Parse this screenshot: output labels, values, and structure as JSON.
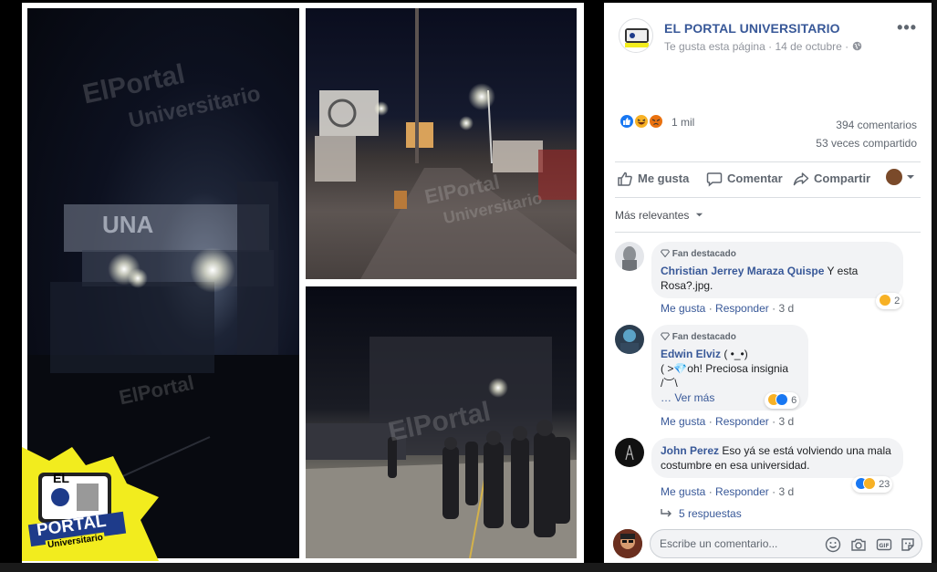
{
  "photos": {
    "watermark_text_1": "ElPortal",
    "watermark_text_2": "Universitario",
    "sign_text": "UNA",
    "logo_line1": "EL",
    "logo_line2": "PORTAL",
    "logo_line3": "Universitario"
  },
  "post": {
    "page_name": "EL PORTAL UNIVERSITARIO",
    "liked_label": "Te gusta esta página",
    "separator": "·",
    "date": "14 de octubre",
    "visibility_icon": "globe-icon",
    "more_label": "•••"
  },
  "summary": {
    "reaction_count": "1 mil",
    "comments_count": "394 comentarios",
    "shares_count": "53 veces compartido",
    "reaction_icons": [
      "like-icon",
      "haha-icon",
      "angry-icon"
    ],
    "colors": {
      "like": "#1877f2",
      "haha": "#f7b125",
      "angry": "#e9710f"
    }
  },
  "actions": {
    "like_label": "Me gusta",
    "comment_label": "Comentar",
    "share_label": "Compartir"
  },
  "filter": {
    "label": "Más relevantes"
  },
  "comments": [
    {
      "badge": "Fan destacado",
      "author": "Christian Jerrey Maraza Quispe",
      "text": " Y esta Rosa?.jpg.",
      "like": "Me gusta",
      "reply": "Responder",
      "time": "3 d",
      "reaction_count": "2"
    },
    {
      "badge": "Fan destacado",
      "author": "Edwin Elviz",
      "text_line1": " ( •_•)",
      "text_line2": "( >💎oh! Preciosa insignia",
      "text_line3": "/︶\\",
      "see_more": "… Ver más",
      "like": "Me gusta",
      "reply": "Responder",
      "time": "3 d",
      "reaction_count": "6"
    },
    {
      "author": "John Perez",
      "text": " Eso yá se está volviendo una mala costumbre en esa universidad.",
      "like": "Me gusta",
      "reply": "Responder",
      "time": "3 d",
      "reaction_count": "23"
    }
  ],
  "replies_label": "5 respuestas",
  "composer": {
    "placeholder": "Escribe un comentario..."
  }
}
